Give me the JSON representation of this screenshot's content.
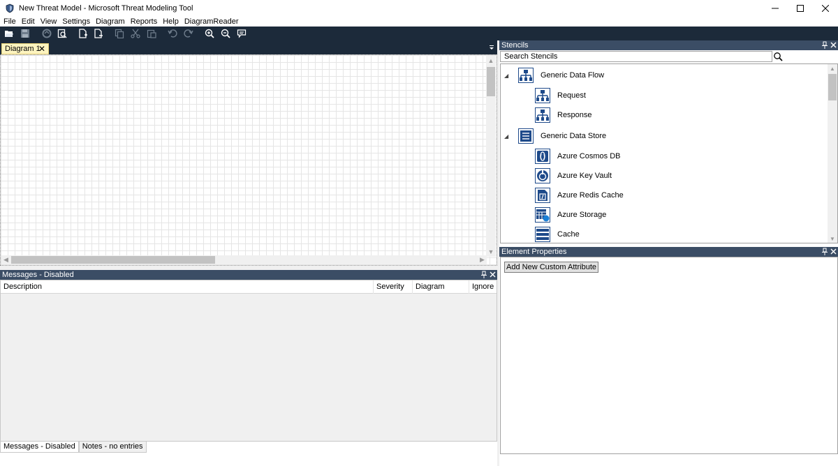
{
  "window": {
    "title": "New Threat Model - Microsoft Threat Modeling Tool",
    "minimize": "—",
    "maximize": "☐",
    "close": "✕"
  },
  "menu": [
    "File",
    "Edit",
    "View",
    "Settings",
    "Diagram",
    "Reports",
    "Help",
    "DiagramReader"
  ],
  "toolbar": {
    "icons": [
      "open-icon",
      "save-icon",
      "analyze-icon",
      "report-icon",
      "new-diagram-icon",
      "delete-diagram-icon",
      "copy-icon",
      "cut-icon",
      "paste-icon",
      "undo-icon",
      "redo-icon",
      "zoom-in-icon",
      "zoom-out-icon",
      "comment-icon"
    ]
  },
  "tabs": {
    "diagram_tab_label": "Diagram 1",
    "close_glyph": "✕"
  },
  "messages_panel": {
    "title": "Messages - Disabled",
    "pin_glyph": "📌",
    "close_glyph": "✕",
    "columns": [
      "Description",
      "Severity",
      "Diagram",
      "Ignore"
    ]
  },
  "bottom_tabs": [
    "Messages - Disabled",
    "Notes - no entries"
  ],
  "stencils_panel": {
    "title": "Stencils",
    "search_placeholder": "Search Stencils",
    "groups": [
      {
        "label": "Generic Data Flow",
        "expander": "◢",
        "icon": "data-flow-icon",
        "items": [
          {
            "label": "Request",
            "icon": "request-icon"
          },
          {
            "label": "Response",
            "icon": "response-icon"
          }
        ]
      },
      {
        "label": "Generic Data Store",
        "expander": "◢",
        "icon": "data-store-icon",
        "items": [
          {
            "label": "Azure Cosmos DB",
            "icon": "cosmos-db-icon"
          },
          {
            "label": "Azure Key Vault",
            "icon": "key-vault-icon"
          },
          {
            "label": "Azure Redis Cache",
            "icon": "redis-cache-icon"
          },
          {
            "label": "Azure Storage",
            "icon": "storage-icon"
          },
          {
            "label": "Cache",
            "icon": "cache-icon"
          }
        ]
      }
    ]
  },
  "properties_panel": {
    "title": "Element Properties",
    "add_button": "Add New Custom Attribute"
  },
  "colors": {
    "toolbar_bg": "#1c2a3a",
    "panel_header_bg": "#3b4d65",
    "tab_bg": "#fdf4bf",
    "icon_blue": "#1e4a8a"
  }
}
